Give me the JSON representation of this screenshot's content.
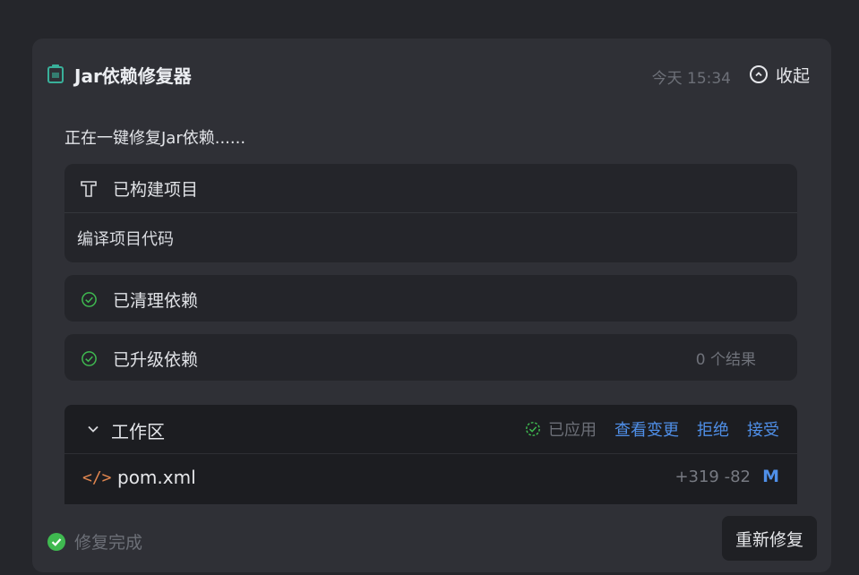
{
  "app": {
    "title": "Jar依赖修复器",
    "timestamp": "今天 15:34",
    "collapse_label": "收起",
    "status_line": "正在一键修复Jar依赖......"
  },
  "steps": {
    "build": {
      "label": "已构建项目",
      "detail": "编译项目代码",
      "icon": "hammer-icon"
    },
    "clean": {
      "label": "已清理依赖",
      "icon": "check-circle-icon"
    },
    "upgrade": {
      "label": "已升级依赖",
      "count": "0 个结果",
      "icon": "check-circle-icon"
    }
  },
  "workspace": {
    "title": "工作区",
    "applied_label": "已应用",
    "view_changes": "查看变更",
    "reject": "拒绝",
    "accept": "接受",
    "files": [
      {
        "icon": "</>",
        "name": "pom.xml",
        "diff": "+319 -82",
        "status": "M"
      }
    ]
  },
  "footer": {
    "status": "修复完成",
    "retry_label": "重新修复"
  },
  "colors": {
    "success": "#3fb950",
    "link": "#4f8fe8",
    "file_icon": "#e1864f"
  }
}
